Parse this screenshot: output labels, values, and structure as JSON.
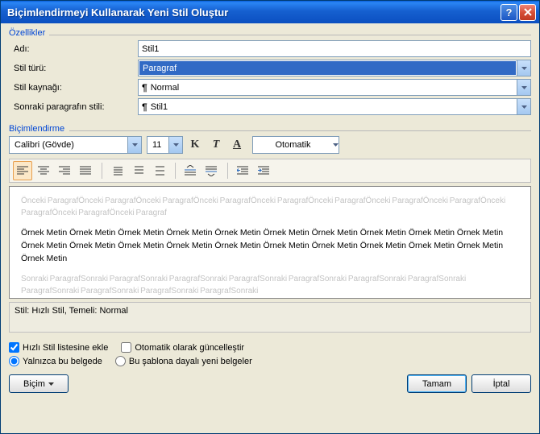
{
  "titlebar": {
    "title": "Biçimlendirmeyi Kullanarak Yeni Stil Oluştur"
  },
  "properties": {
    "legend": "Özellikler",
    "name_label": "Adı:",
    "name_value": "Stil1",
    "type_label": "Stil türü:",
    "type_value": "Paragraf",
    "source_label": "Stil kaynağı:",
    "source_value": "Normal",
    "next_label": "Sonraki paragrafın stili:",
    "next_value": "Stil1"
  },
  "formatting": {
    "legend": "Biçimlendirme",
    "font_name": "Calibri (Gövde)",
    "font_size": "11",
    "bold_glyph": "K",
    "italic_glyph": "T",
    "underline_glyph": "A",
    "color_label": "Otomatik"
  },
  "preview": {
    "before": "Önceki ParagrafÖnceki ParagrafÖnceki ParagrafÖnceki ParagrafÖnceki ParagrafÖnceki ParagrafÖnceki ParagrafÖnceki ParagrafÖnceki ParagrafÖnceki ParagrafÖnceki Paragraf",
    "sample": "Örnek Metin Örnek Metin Örnek Metin Örnek Metin Örnek Metin Örnek Metin Örnek Metin Örnek Metin Örnek Metin Örnek Metin Örnek Metin Örnek Metin Örnek Metin Örnek Metin Örnek Metin Örnek Metin Örnek Metin Örnek Metin Örnek Metin Örnek Metin Örnek Metin",
    "after": "Sonraki ParagrafSonraki ParagrafSonraki ParagrafSonraki ParagrafSonraki ParagrafSonraki ParagrafSonraki ParagrafSonraki ParagrafSonraki ParagrafSonraki ParagrafSonraki ParagrafSonraki"
  },
  "desc": "Stil: Hızlı Stil, Temeli: Normal",
  "options": {
    "quicklist": "Hızlı Stil listesine ekle",
    "autoupdate": "Otomatik olarak güncelleştir",
    "thisdoc": "Yalnızca bu belgede",
    "template": "Bu şablona dayalı yeni belgeler"
  },
  "buttons": {
    "format": "Biçim",
    "ok": "Tamam",
    "cancel": "İptal"
  }
}
